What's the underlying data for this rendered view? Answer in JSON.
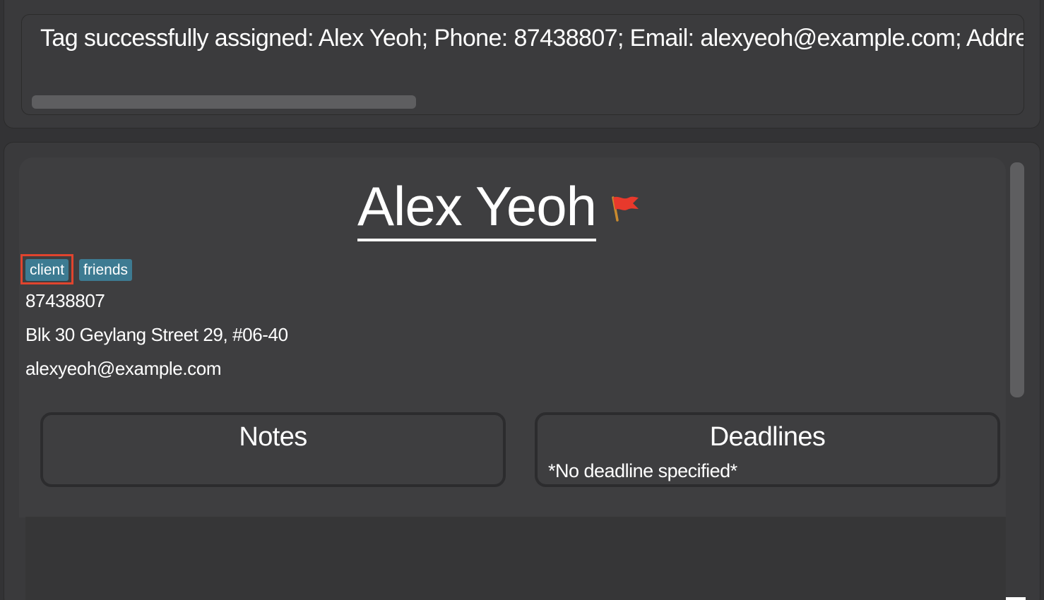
{
  "result_display": {
    "message": "Tag successfully assigned: Alex Yeoh; Phone: 87438807; Email: alexyeoh@example.com; Addre"
  },
  "person_card": {
    "name": "Alex Yeoh",
    "flag_icon": "red-flag-icon",
    "tags": [
      {
        "label": "client",
        "highlighted": true
      },
      {
        "label": "friends",
        "highlighted": false
      }
    ],
    "phone": "87438807",
    "address": "Blk 30 Geylang Street 29, #06-40",
    "email": "alexyeoh@example.com",
    "notes": {
      "title": "Notes"
    },
    "deadlines": {
      "title": "Deadlines",
      "empty_text": "*No deadline specified*"
    }
  },
  "colors": {
    "background": "#3a3a3c",
    "tag": "#3d7b92",
    "highlight": "#e0442e",
    "flag": "#e8392c"
  }
}
